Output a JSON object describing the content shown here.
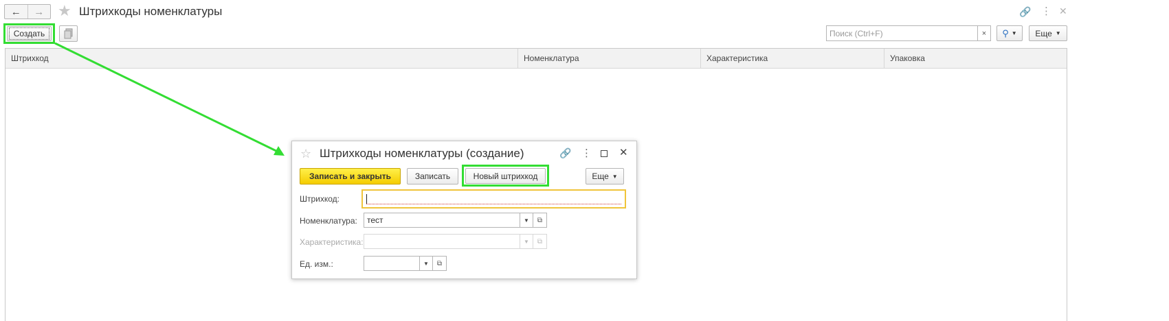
{
  "window": {
    "title": "Штрихкоды номенклатуры",
    "back_icon": "arrow-left-icon",
    "forward_icon": "arrow-right-icon",
    "favorite_icon": "star-icon",
    "link_icon": "link-icon",
    "more_icon": "vertical-dots-icon",
    "close_icon": "close-icon"
  },
  "toolbar": {
    "create_label": "Создать",
    "copy_icon": "copy-document-icon",
    "search_placeholder": "Поиск (Ctrl+F)",
    "clear_label": "×",
    "search_icon": "magnifier-icon",
    "more_label": "Еще"
  },
  "table": {
    "columns": [
      "Штрихкод",
      "Номенклатура",
      "Характеристика",
      "Упаковка"
    ],
    "rows": []
  },
  "dialog": {
    "title": "Штрихкоды номенклатуры (создание)",
    "save_close_label": "Записать и закрыть",
    "save_label": "Записать",
    "new_barcode_label": "Новый штрихкод",
    "more_label": "Еще",
    "fields": {
      "barcode_label": "Штрихкод:",
      "barcode_value": "",
      "nomenclature_label": "Номенклатура:",
      "nomenclature_value": "тест",
      "characteristic_label": "Характеристика:",
      "characteristic_value": "",
      "unit_label": "Ед. изм.:",
      "unit_value": ""
    }
  },
  "colors": {
    "highlight_green": "#33dd33",
    "primary_yellow": "#f5d400",
    "focus_border": "#f0c43a"
  }
}
